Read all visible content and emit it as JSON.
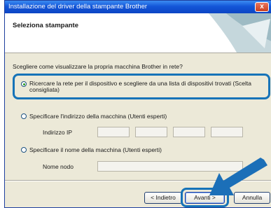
{
  "window": {
    "title": "Installazione del driver della stampante Brother",
    "close_glyph": "x"
  },
  "header": {
    "title": "Seleziona stampante"
  },
  "main": {
    "question": "Scegliere come visualizzare la propria macchina Brother in rete?",
    "options": [
      {
        "line1": "Ricercare la rete per il dispositivo e scegliere da una lista di dispositivi trovati (Scelta",
        "line2": "consigliata)",
        "checked": true
      },
      {
        "label": "Specificare l'indirizzo della macchina (Utenti esperti)",
        "checked": false
      },
      {
        "label": "Specificare il nome della macchina (Utenti esperti)",
        "checked": false
      }
    ],
    "ip_label": "Indirizzo IP",
    "node_label": "Nome nodo"
  },
  "footer": {
    "back_label": "< Indietro",
    "next_label": "Avanti >",
    "cancel_label": "Annulla"
  },
  "colors": {
    "titlebar": "#1356d8",
    "highlight": "#1673b8",
    "arrow": "#1b6fb8"
  }
}
